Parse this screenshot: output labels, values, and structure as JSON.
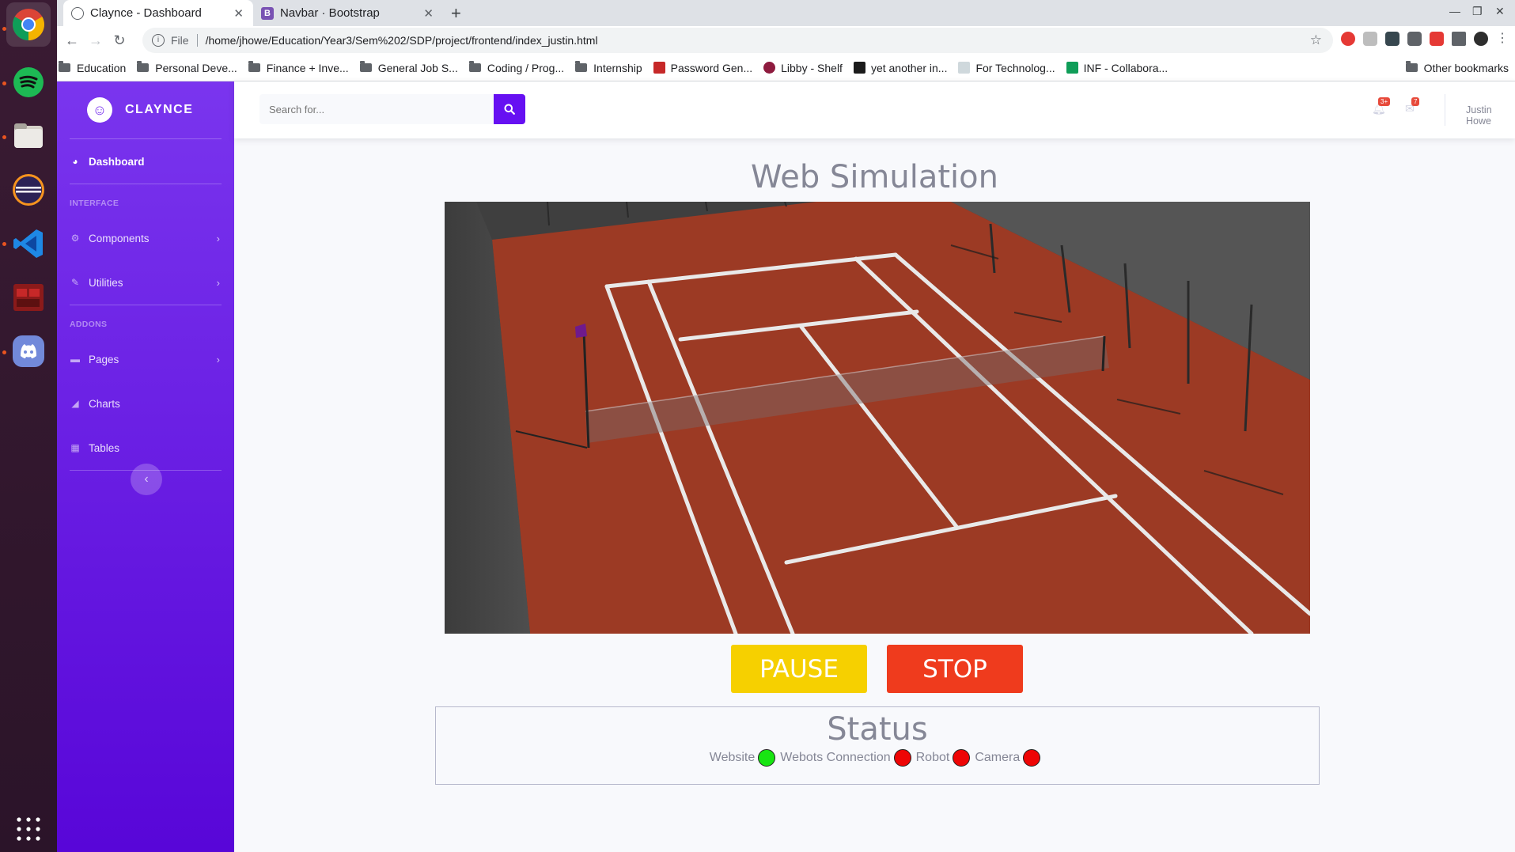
{
  "dock": {
    "apps": [
      "chrome-icon",
      "spotify-icon",
      "files-icon",
      "eclipse-icon",
      "vscode-icon",
      "terminal-icon",
      "discord-icon"
    ],
    "grid": "apps-grid-icon"
  },
  "browser": {
    "tabs": [
      {
        "title": "Claynce - Dashboard",
        "active": true
      },
      {
        "title": "Navbar · Bootstrap",
        "active": false
      }
    ],
    "url_scheme": "File",
    "url": "/home/jhowe/Education/Year3/Sem%202/SDP/project/frontend/index_justin.html",
    "bookmarks": [
      {
        "label": "Education",
        "type": "folder"
      },
      {
        "label": "Personal Deve...",
        "type": "folder"
      },
      {
        "label": "Finance + Inve...",
        "type": "folder"
      },
      {
        "label": "General Job S...",
        "type": "folder"
      },
      {
        "label": "Coding / Prog...",
        "type": "folder"
      },
      {
        "label": "Internship",
        "type": "folder"
      },
      {
        "label": "Password Gen...",
        "type": "site"
      },
      {
        "label": "Libby - Shelf",
        "type": "site"
      },
      {
        "label": "yet another in...",
        "type": "site"
      },
      {
        "label": "For Technolog...",
        "type": "site"
      },
      {
        "label": "INF - Collabora...",
        "type": "site"
      }
    ],
    "other_bookmarks": "Other bookmarks"
  },
  "sidebar": {
    "brand": "CLAYNCE",
    "dashboard": "Dashboard",
    "heading_interface": "INTERFACE",
    "components": "Components",
    "utilities": "Utilities",
    "heading_addons": "ADDONS",
    "pages": "Pages",
    "charts": "Charts",
    "tables": "Tables"
  },
  "topbar": {
    "search_placeholder": "Search for...",
    "alerts_badge": "3+",
    "messages_badge": "7",
    "user_name": "Justin Howe"
  },
  "main": {
    "title": "Web Simulation",
    "pause_label": "PAUSE",
    "stop_label": "STOP",
    "status_title": "Status",
    "status_items": [
      {
        "label": "Website",
        "state": "online",
        "color": "#18e512"
      },
      {
        "label": "Webots Connection",
        "state": "offline",
        "color": "#ee0505"
      },
      {
        "label": "Robot",
        "state": "offline",
        "color": "#ee0505"
      },
      {
        "label": "Camera",
        "state": "offline",
        "color": "#ee0505"
      }
    ]
  },
  "colors": {
    "sidebar_top": "#7a35ee",
    "sidebar_bottom": "#5806d8",
    "pause": "#f6d000",
    "stop": "#ef3b1d",
    "court": "#9c3a24"
  }
}
